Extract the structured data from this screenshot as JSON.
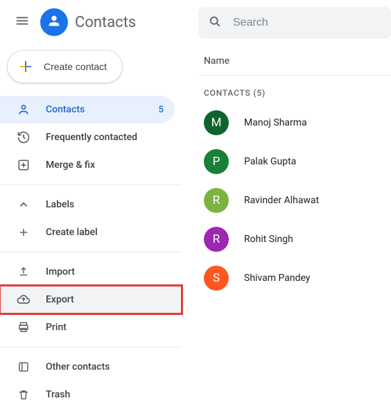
{
  "header": {
    "app_title": "Contacts",
    "create_label": "Create contact"
  },
  "search": {
    "placeholder": "Search"
  },
  "nav": {
    "contacts": {
      "label": "Contacts",
      "count": "5"
    },
    "frequent": {
      "label": "Frequently contacted"
    },
    "merge": {
      "label": "Merge & fix"
    },
    "labels": {
      "label": "Labels"
    },
    "create_label": {
      "label": "Create label"
    },
    "import": {
      "label": "Import"
    },
    "export": {
      "label": "Export"
    },
    "print": {
      "label": "Print"
    },
    "other": {
      "label": "Other contacts"
    },
    "trash": {
      "label": "Trash"
    }
  },
  "main": {
    "column_header": "Name",
    "section_label": "CONTACTS (5)",
    "rows": [
      {
        "initial": "M",
        "name": "Manoj Sharma",
        "color": "#0d652d"
      },
      {
        "initial": "P",
        "name": "Palak Gupta",
        "color": "#188038"
      },
      {
        "initial": "R",
        "name": "Ravinder Alhawat",
        "color": "#7cb342"
      },
      {
        "initial": "R",
        "name": "Rohit Singh",
        "color": "#9c27b0"
      },
      {
        "initial": "S",
        "name": "Shivam Pandey",
        "color": "#ff5722"
      }
    ]
  }
}
